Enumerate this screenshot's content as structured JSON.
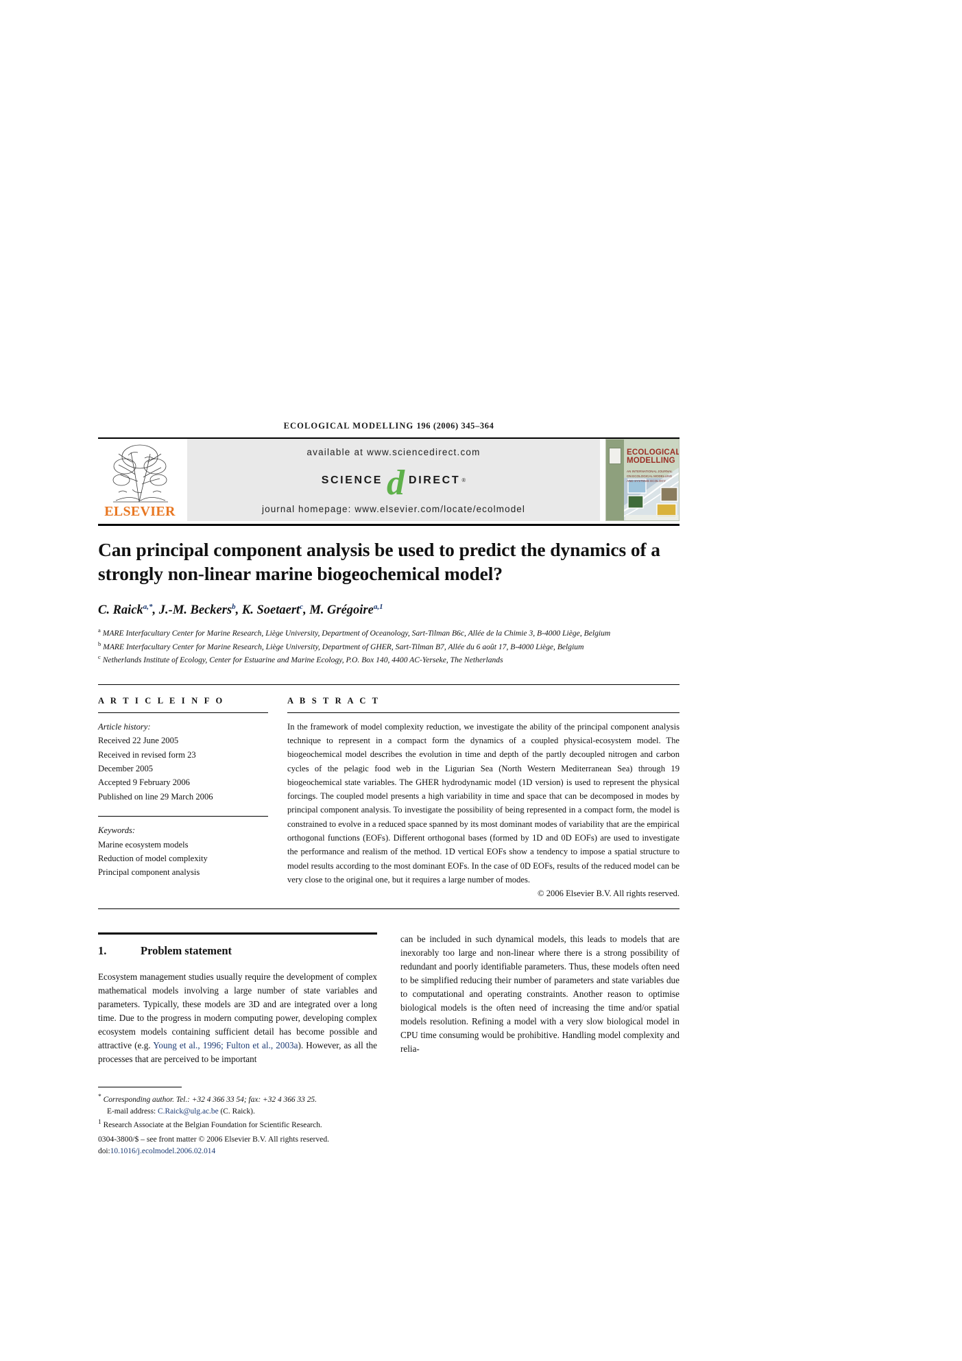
{
  "running_head": {
    "journal": "ECOLOGICAL MODELLING",
    "volume_info": "196 (2006) 345–364"
  },
  "masthead": {
    "publisher": "ELSEVIER",
    "available_at": "available at www.sciencedirect.com",
    "sciencedirect_left": "SCIENCE",
    "sciencedirect_mark": "d",
    "sciencedirect_right": "DIRECT",
    "registered_mark": "®",
    "journal_homepage": "journal homepage: www.elsevier.com/locate/ecolmodel",
    "cover_title_line1": "ECOLOGICAL",
    "cover_title_line2": "MODELLING",
    "cover_subtitle": "AN INTERNATIONAL JOURNAL ON ECOLOGICAL MODELLING AND SYSTEMS ECOLOGY"
  },
  "article": {
    "title": "Can principal component analysis be used to predict the dynamics of a strongly non-linear marine biogeochemical model?",
    "authors_html": "C. Raick<sup>a,*</sup>, J.-M. Beckers<sup>b</sup>, K. Soetaert<sup>c</sup>, M. Grégoire<sup>a,1</sup>",
    "affiliations": [
      "MARE Interfacultary Center for Marine Research, Liège University, Department of Oceanology, Sart-Tilman B6c, Allée de la Chimie 3, B-4000 Liège, Belgium",
      "MARE Interfacultary Center for Marine Research, Liège University, Department of GHER, Sart-Tilman B7, Allée du 6 août 17, B-4000 Liège, Belgium",
      "Netherlands Institute of Ecology, Center for Estuarine and Marine Ecology, P.O. Box 140, 4400 AC-Yerseke, The Netherlands"
    ],
    "affiliation_markers": [
      "a",
      "b",
      "c"
    ]
  },
  "article_info": {
    "label": "A R T I C L E   I N F O",
    "history_heading": "Article history:",
    "history": [
      "Received 22 June 2005",
      "Received in revised form 23",
      "December 2005",
      "Accepted 9 February 2006",
      "Published on line 29 March 2006"
    ],
    "keywords_heading": "Keywords:",
    "keywords": [
      "Marine ecosystem models",
      "Reduction of model complexity",
      "Principal component analysis"
    ]
  },
  "abstract": {
    "label": "A B S T R A C T",
    "text": "In the framework of model complexity reduction, we investigate the ability of the principal component analysis technique to represent in a compact form the dynamics of a coupled physical-ecosystem model. The biogeochemical model describes the evolution in time and depth of the partly decoupled nitrogen and carbon cycles of the pelagic food web in the Ligurian Sea (North Western Mediterranean Sea) through 19 biogeochemical state variables. The GHER hydrodynamic model (1D version) is used to represent the physical forcings. The coupled model presents a high variability in time and space that can be decomposed in modes by principal component analysis. To investigate the possibility of being represented in a compact form, the model is constrained to evolve in a reduced space spanned by its most dominant modes of variability that are the empirical orthogonal functions (EOFs). Different orthogonal bases (formed by 1D and 0D EOFs) are used to investigate the performance and realism of the method. 1D vertical EOFs show a tendency to impose a spatial structure to model results according to the most dominant EOFs. In the case of 0D EOFs, results of the reduced model can be very close to the original one, but it requires a large number of modes.",
    "copyright": "© 2006 Elsevier B.V. All rights reserved."
  },
  "section1": {
    "number": "1.",
    "heading": "Problem statement",
    "left_column_html": "Ecosystem management studies usually require the development of complex mathematical models involving a large number of state variables and parameters. Typically, these models are 3D and are integrated over a long time. Due to the progress in modern computing power, developing complex ecosystem models containing sufficient detail has become possible and attractive (e.g. <span class=\"cit\">Young et al., 1996; Fulton et al., 2003a</span>). However, as all the processes that are perceived to be important",
    "right_column_text": "can be included in such dynamical models, this leads to models that are inexorably too large and non-linear where there is a strong possibility of redundant and poorly identifiable parameters. Thus, these models often need to be simplified reducing their number of parameters and state variables due to computational and operating constraints. Another reason to optimise biological models is the often need of increasing the time and/or spatial models resolution. Refining a model with a very slow biological model in CPU time consuming would be prohibitive. Handling model complexity and relia-"
  },
  "footnotes": {
    "corresponding": "Corresponding author. Tel.: +32 4 366 33 54; fax: +32 4 366 33 25.",
    "corresponding_marker": "*",
    "email_label": "E-mail address:",
    "email": "C.Raick@ulg.ac.be",
    "email_owner": "(C. Raick).",
    "note1_marker": "1",
    "note1": "Research Associate at the Belgian Foundation for Scientific Research.",
    "issn_line": "0304-3800/$ – see front matter © 2006 Elsevier B.V. All rights reserved.",
    "doi_label": "doi:",
    "doi": "10.1016/j.ecolmodel.2006.02.014"
  },
  "colors": {
    "elsevier_orange": "#E87722",
    "sciencedirect_green": "#5fb14b",
    "link_blue": "#1b3a73",
    "band_gray": "#e9e9e9"
  }
}
